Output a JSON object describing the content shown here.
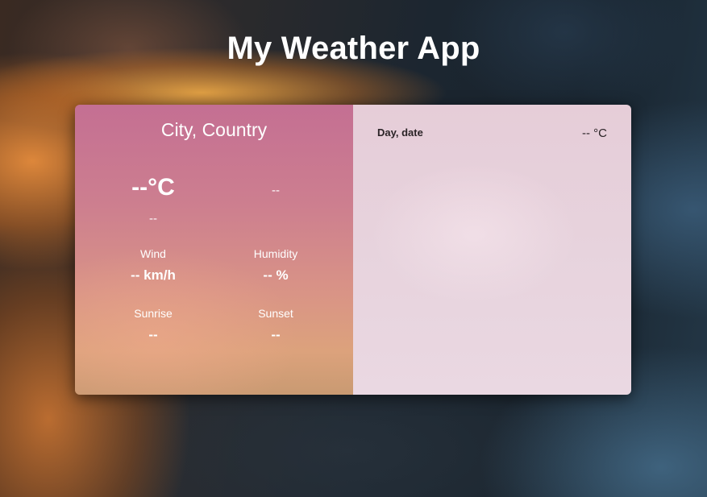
{
  "header": {
    "title": "My Weather App"
  },
  "current": {
    "location": "City, Country",
    "temperature": "--°C",
    "description": "--",
    "feels_like": "--",
    "wind_label": "Wind",
    "wind_value": "-- km/h",
    "humidity_label": "Humidity",
    "humidity_value": "-- %",
    "sunrise_label": "Sunrise",
    "sunrise_value": "--",
    "sunset_label": "Sunset",
    "sunset_value": "--"
  },
  "forecast": {
    "day_date": "Day, date",
    "temperature": "-- °C"
  }
}
